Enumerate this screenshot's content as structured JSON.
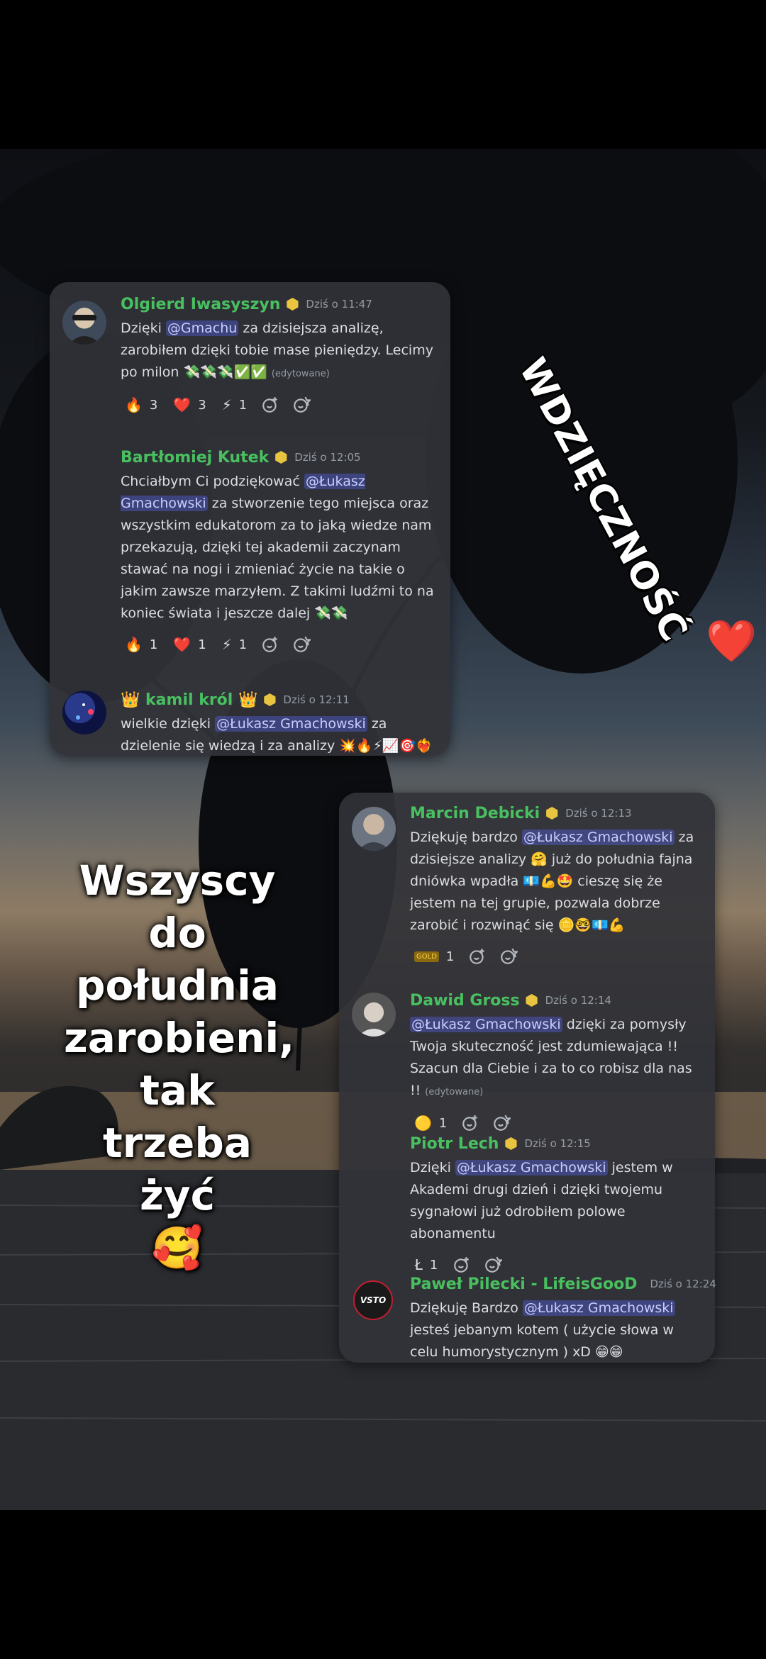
{
  "overlay": {
    "top_title": "WDZIĘCZNOŚĆ",
    "heart": "❤️",
    "caption_lines": [
      "Wszyscy",
      "do",
      "południa",
      "zarobieni,",
      "tak",
      "trzeba",
      "żyć"
    ],
    "caption_emoji": "🥰"
  },
  "card1": {
    "messages": [
      {
        "author": "Olgierd Iwasyszyn",
        "time": "Dziś o 11:47",
        "segments": [
          {
            "t": "Dzięki "
          },
          {
            "m": "@Gmachu"
          },
          {
            "t": "  za dzisiejsza analizę, zarobiłem dzięki tobie mase pieniędzy. Lecimy po milon 💸💸💸✅✅ "
          },
          {
            "e": "(edytowane)"
          }
        ],
        "reactions": [
          {
            "emoji": "🔥",
            "count": "3"
          },
          {
            "emoji": "❤️",
            "count": "3"
          },
          {
            "emoji": "⚡",
            "count": "1"
          }
        ]
      },
      {
        "author": "Bartłomiej Kutek",
        "time": "Dziś o 12:05",
        "segments": [
          {
            "t": "Chciałbym Ci podziękować "
          },
          {
            "m": "@Łukasz Gmachowski"
          },
          {
            "t": " za stworzenie tego miejsca oraz wszystkim edukatorom za to jaką wiedze nam przekazują, dzięki tej akademii zaczynam stawać na nogi i zmieniać życie na takie o jakim zawsze marzyłem. Z takimi ludźmi to na koniec świata i jeszcze dalej 💸💸"
          }
        ],
        "reactions": [
          {
            "emoji": "🔥",
            "count": "1"
          },
          {
            "emoji": "❤️",
            "count": "1"
          },
          {
            "emoji": "⚡",
            "count": "1"
          }
        ]
      },
      {
        "author": "👑 kamil król 👑",
        "time": "Dziś o 12:11",
        "segments": [
          {
            "t": "wielkie dzięki "
          },
          {
            "m": "@Łukasz Gmachowski"
          },
          {
            "t": " za dzielenie się wiedzą i za analizy 💥🔥⚡📈🎯❤️‍🔥"
          }
        ],
        "reactions": []
      }
    ]
  },
  "card2": {
    "messages": [
      {
        "author": "Marcin Debicki",
        "time": "Dziś o 12:13",
        "segments": [
          {
            "t": "Dziękuję bardzo "
          },
          {
            "m": "@Łukasz Gmachowski"
          },
          {
            "t": " za dzisiejsze analizy 🤗 już do południa fajna dniówka wpadła 💶💪🤩 cieszę się że jestem na tej grupie, pozwala dobrze zarobić i rozwinąć się 🪙🤓💶💪"
          }
        ],
        "reactions": [
          {
            "emoji": "GOLD",
            "count": "1"
          }
        ]
      },
      {
        "author": "Dawid Gross",
        "time": "Dziś o 12:14",
        "segments": [
          {
            "m": "@Łukasz Gmachowski"
          },
          {
            "t": "  dzięki za pomysły Twoja skuteczność jest zdumiewająca !! Szacun dla Ciebie i za to co robisz dla nas !! "
          },
          {
            "e": "(edytowane)"
          }
        ],
        "reactions": [
          {
            "emoji": "🟡",
            "count": "1"
          }
        ]
      },
      {
        "author": "Piotr Lech",
        "time": "Dziś o 12:15",
        "segments": [
          {
            "t": "Dzięki "
          },
          {
            "m": "@Łukasz Gmachowski"
          },
          {
            "t": "  jestem w Akademi drugi dzień i dzięki twojemu sygnałowi już odrobiłem polowe abonamentu"
          }
        ],
        "reactions": [
          {
            "emoji": "Ł",
            "count": "1"
          }
        ]
      },
      {
        "author": "Paweł Pilecki - LifeisGooD",
        "time": "Dziś o 12:24",
        "segments": [
          {
            "t": "Dziękuję Bardzo "
          },
          {
            "m": "@Łukasz Gmachowski"
          },
          {
            "t": " jesteś jebanym kotem ( użycie słowa w celu humorystycznym ) xD 😁😁"
          }
        ],
        "reactions": []
      }
    ]
  },
  "avatars": {
    "paweł_logo_text": "VSTO"
  },
  "colors": {
    "card_bg": "#313338",
    "author_green": "#49c060",
    "mention_bg": "#5865f2",
    "text": "#dbdee1",
    "muted": "#949ba4",
    "badge_gold": "#e9c440"
  }
}
